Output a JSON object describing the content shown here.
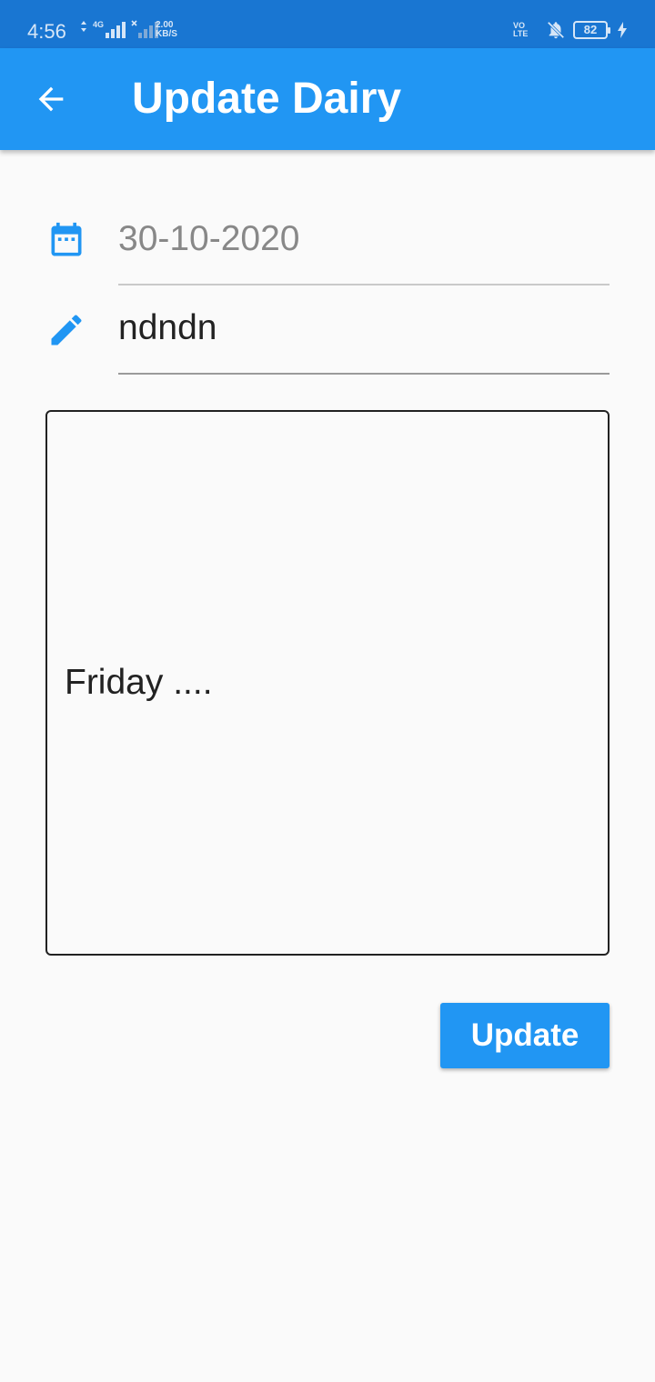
{
  "status_bar": {
    "time": "4:56",
    "network_type": "4G",
    "data_rate_value": "2.00",
    "data_rate_unit": "KB/S",
    "volte_line1": "VO",
    "volte_line2": "LTE",
    "battery": "82",
    "icons": [
      "data-arrows-icon",
      "signal-icon",
      "signal-no-service-icon",
      "notifications-off-icon",
      "battery-icon",
      "charging-icon"
    ]
  },
  "app_bar": {
    "title": "Update Dairy",
    "back_icon": "arrow-back-icon",
    "background": "#2196f3"
  },
  "form": {
    "date": {
      "icon": "calendar-icon",
      "value": "30-10-2020"
    },
    "title": {
      "icon": "pencil-icon",
      "value": "ndndn"
    },
    "body": {
      "value": "Friday ...."
    }
  },
  "update_button": {
    "label": "Update"
  },
  "colors": {
    "primary": "#2196f3",
    "status_bar": "#1976d2",
    "background": "#fafafa"
  }
}
